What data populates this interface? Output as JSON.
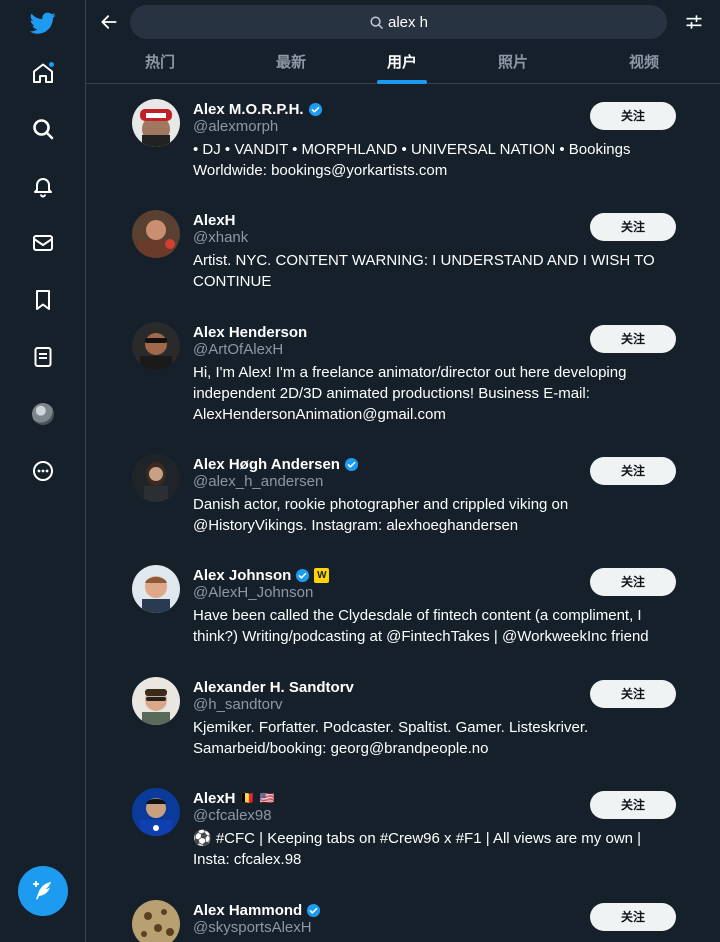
{
  "search": {
    "query": "alex h"
  },
  "tabs": [
    {
      "label": "热门"
    },
    {
      "label": "最新"
    },
    {
      "label": "用户"
    },
    {
      "label": "照片"
    },
    {
      "label": "视频"
    }
  ],
  "active_tab": "用户",
  "colors": {
    "background": "#15202b",
    "accent": "#1d9bf0",
    "secondary_text": "#8b98a5",
    "follow_button": "#eff3f4"
  },
  "sidebar_icons": [
    "twitter-logo-icon",
    "home-icon",
    "search-icon",
    "bell-icon",
    "mail-icon",
    "bookmark-icon",
    "list-icon",
    "profile-avatar",
    "more-icon"
  ],
  "users": [
    {
      "name": "Alex M.O.R.P.H.",
      "handle": "@alexmorph",
      "verified": true,
      "bio": "• DJ • VANDIT • MORPHLAND • UNIVERSAL NATION • Bookings Worldwide: bookings@yorkartists.com",
      "follow_label": "关注"
    },
    {
      "name": "AlexH",
      "handle": "@xhank",
      "verified": false,
      "bio": "Artist. NYC. CONTENT WARNING: I UNDERSTAND AND I WISH TO CONTINUE",
      "follow_label": "关注"
    },
    {
      "name": "Alex Henderson",
      "handle": "@ArtOfAlexH",
      "verified": false,
      "bio": "Hi, I'm Alex! I'm a freelance animator/director out here developing independent 2D/3D animated productions! Business E-mail: AlexHendersonAnimation@gmail.com",
      "follow_label": "关注"
    },
    {
      "name": "Alex Høgh Andersen",
      "handle": "@alex_h_andersen",
      "verified": true,
      "bio": "Danish actor, rookie photographer and crippled viking on @HistoryVikings. Instagram: alexhoeghandersen",
      "follow_label": "关注"
    },
    {
      "name": "Alex Johnson",
      "handle": "@AlexH_Johnson",
      "verified": true,
      "affiliate_badge": "W",
      "bio": "Have been called the Clydesdale of fintech content (a compliment, I think?) Writing/podcasting at @FintechTakes | @WorkweekInc friend",
      "follow_label": "关注"
    },
    {
      "name": "Alexander H. Sandtorv",
      "handle": "@h_sandtorv",
      "verified": false,
      "bio": "Kjemiker. Forfatter. Podcaster. Spaltist. Gamer. Listeskriver. Samarbeid/booking: georg@brandpeople.no",
      "follow_label": "关注"
    },
    {
      "name": "AlexH",
      "name_flags": "🇧🇪 🇺🇸",
      "handle": "@cfcalex98",
      "verified": false,
      "bio": "⚽ #CFC | Keeping tabs on #Crew96 x #F1 | All views are my own | Insta: cfcalex.98",
      "follow_label": "关注"
    },
    {
      "name": "Alex Hammond",
      "handle": "@skysportsAlexH",
      "verified": true,
      "bio": "",
      "follow_label": "关注"
    }
  ]
}
